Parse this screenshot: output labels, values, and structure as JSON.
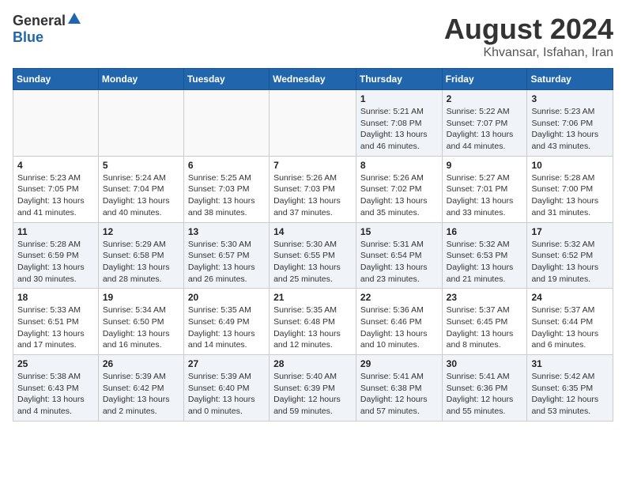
{
  "header": {
    "logo_general": "General",
    "logo_blue": "Blue",
    "month_year": "August 2024",
    "location": "Khvansar, Isfahan, Iran"
  },
  "days_of_week": [
    "Sunday",
    "Monday",
    "Tuesday",
    "Wednesday",
    "Thursday",
    "Friday",
    "Saturday"
  ],
  "weeks": [
    [
      {
        "day": "",
        "sunrise": "",
        "sunset": "",
        "daylight": ""
      },
      {
        "day": "",
        "sunrise": "",
        "sunset": "",
        "daylight": ""
      },
      {
        "day": "",
        "sunrise": "",
        "sunset": "",
        "daylight": ""
      },
      {
        "day": "",
        "sunrise": "",
        "sunset": "",
        "daylight": ""
      },
      {
        "day": "1",
        "sunrise": "Sunrise: 5:21 AM",
        "sunset": "Sunset: 7:08 PM",
        "daylight": "Daylight: 13 hours and 46 minutes."
      },
      {
        "day": "2",
        "sunrise": "Sunrise: 5:22 AM",
        "sunset": "Sunset: 7:07 PM",
        "daylight": "Daylight: 13 hours and 44 minutes."
      },
      {
        "day": "3",
        "sunrise": "Sunrise: 5:23 AM",
        "sunset": "Sunset: 7:06 PM",
        "daylight": "Daylight: 13 hours and 43 minutes."
      }
    ],
    [
      {
        "day": "4",
        "sunrise": "Sunrise: 5:23 AM",
        "sunset": "Sunset: 7:05 PM",
        "daylight": "Daylight: 13 hours and 41 minutes."
      },
      {
        "day": "5",
        "sunrise": "Sunrise: 5:24 AM",
        "sunset": "Sunset: 7:04 PM",
        "daylight": "Daylight: 13 hours and 40 minutes."
      },
      {
        "day": "6",
        "sunrise": "Sunrise: 5:25 AM",
        "sunset": "Sunset: 7:03 PM",
        "daylight": "Daylight: 13 hours and 38 minutes."
      },
      {
        "day": "7",
        "sunrise": "Sunrise: 5:26 AM",
        "sunset": "Sunset: 7:03 PM",
        "daylight": "Daylight: 13 hours and 37 minutes."
      },
      {
        "day": "8",
        "sunrise": "Sunrise: 5:26 AM",
        "sunset": "Sunset: 7:02 PM",
        "daylight": "Daylight: 13 hours and 35 minutes."
      },
      {
        "day": "9",
        "sunrise": "Sunrise: 5:27 AM",
        "sunset": "Sunset: 7:01 PM",
        "daylight": "Daylight: 13 hours and 33 minutes."
      },
      {
        "day": "10",
        "sunrise": "Sunrise: 5:28 AM",
        "sunset": "Sunset: 7:00 PM",
        "daylight": "Daylight: 13 hours and 31 minutes."
      }
    ],
    [
      {
        "day": "11",
        "sunrise": "Sunrise: 5:28 AM",
        "sunset": "Sunset: 6:59 PM",
        "daylight": "Daylight: 13 hours and 30 minutes."
      },
      {
        "day": "12",
        "sunrise": "Sunrise: 5:29 AM",
        "sunset": "Sunset: 6:58 PM",
        "daylight": "Daylight: 13 hours and 28 minutes."
      },
      {
        "day": "13",
        "sunrise": "Sunrise: 5:30 AM",
        "sunset": "Sunset: 6:57 PM",
        "daylight": "Daylight: 13 hours and 26 minutes."
      },
      {
        "day": "14",
        "sunrise": "Sunrise: 5:30 AM",
        "sunset": "Sunset: 6:55 PM",
        "daylight": "Daylight: 13 hours and 25 minutes."
      },
      {
        "day": "15",
        "sunrise": "Sunrise: 5:31 AM",
        "sunset": "Sunset: 6:54 PM",
        "daylight": "Daylight: 13 hours and 23 minutes."
      },
      {
        "day": "16",
        "sunrise": "Sunrise: 5:32 AM",
        "sunset": "Sunset: 6:53 PM",
        "daylight": "Daylight: 13 hours and 21 minutes."
      },
      {
        "day": "17",
        "sunrise": "Sunrise: 5:32 AM",
        "sunset": "Sunset: 6:52 PM",
        "daylight": "Daylight: 13 hours and 19 minutes."
      }
    ],
    [
      {
        "day": "18",
        "sunrise": "Sunrise: 5:33 AM",
        "sunset": "Sunset: 6:51 PM",
        "daylight": "Daylight: 13 hours and 17 minutes."
      },
      {
        "day": "19",
        "sunrise": "Sunrise: 5:34 AM",
        "sunset": "Sunset: 6:50 PM",
        "daylight": "Daylight: 13 hours and 16 minutes."
      },
      {
        "day": "20",
        "sunrise": "Sunrise: 5:35 AM",
        "sunset": "Sunset: 6:49 PM",
        "daylight": "Daylight: 13 hours and 14 minutes."
      },
      {
        "day": "21",
        "sunrise": "Sunrise: 5:35 AM",
        "sunset": "Sunset: 6:48 PM",
        "daylight": "Daylight: 13 hours and 12 minutes."
      },
      {
        "day": "22",
        "sunrise": "Sunrise: 5:36 AM",
        "sunset": "Sunset: 6:46 PM",
        "daylight": "Daylight: 13 hours and 10 minutes."
      },
      {
        "day": "23",
        "sunrise": "Sunrise: 5:37 AM",
        "sunset": "Sunset: 6:45 PM",
        "daylight": "Daylight: 13 hours and 8 minutes."
      },
      {
        "day": "24",
        "sunrise": "Sunrise: 5:37 AM",
        "sunset": "Sunset: 6:44 PM",
        "daylight": "Daylight: 13 hours and 6 minutes."
      }
    ],
    [
      {
        "day": "25",
        "sunrise": "Sunrise: 5:38 AM",
        "sunset": "Sunset: 6:43 PM",
        "daylight": "Daylight: 13 hours and 4 minutes."
      },
      {
        "day": "26",
        "sunrise": "Sunrise: 5:39 AM",
        "sunset": "Sunset: 6:42 PM",
        "daylight": "Daylight: 13 hours and 2 minutes."
      },
      {
        "day": "27",
        "sunrise": "Sunrise: 5:39 AM",
        "sunset": "Sunset: 6:40 PM",
        "daylight": "Daylight: 13 hours and 0 minutes."
      },
      {
        "day": "28",
        "sunrise": "Sunrise: 5:40 AM",
        "sunset": "Sunset: 6:39 PM",
        "daylight": "Daylight: 12 hours and 59 minutes."
      },
      {
        "day": "29",
        "sunrise": "Sunrise: 5:41 AM",
        "sunset": "Sunset: 6:38 PM",
        "daylight": "Daylight: 12 hours and 57 minutes."
      },
      {
        "day": "30",
        "sunrise": "Sunrise: 5:41 AM",
        "sunset": "Sunset: 6:36 PM",
        "daylight": "Daylight: 12 hours and 55 minutes."
      },
      {
        "day": "31",
        "sunrise": "Sunrise: 5:42 AM",
        "sunset": "Sunset: 6:35 PM",
        "daylight": "Daylight: 12 hours and 53 minutes."
      }
    ]
  ]
}
